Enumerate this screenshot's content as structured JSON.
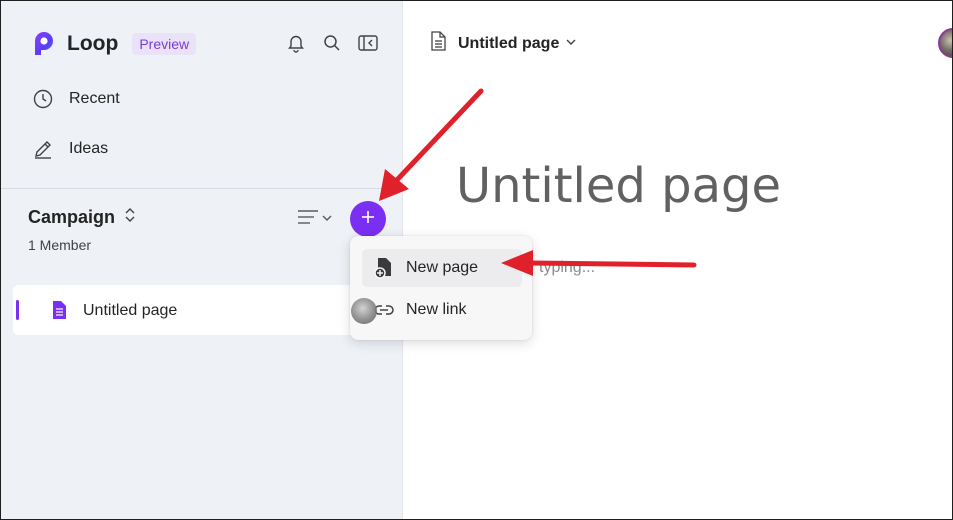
{
  "app": {
    "name": "Loop",
    "badge": "Preview"
  },
  "sidebar": {
    "nav": [
      {
        "label": "Recent",
        "icon": "clock-icon"
      },
      {
        "label": "Ideas",
        "icon": "pencil-icon"
      }
    ],
    "workspace": {
      "title": "Campaign",
      "members": "1 Member"
    },
    "pages": [
      {
        "label": "Untitled page"
      }
    ]
  },
  "header": {
    "page_title": "Untitled page"
  },
  "editor": {
    "title": "Untitled page",
    "placeholder": "typing..."
  },
  "add_menu": {
    "items": [
      {
        "label": "New page",
        "icon": "new-page-icon"
      },
      {
        "label": "New link",
        "icon": "link-icon"
      }
    ]
  },
  "colors": {
    "accent": "#7b2ff2",
    "annotation_arrow": "#e0202a",
    "sidebar_bg": "#eef1f6"
  }
}
